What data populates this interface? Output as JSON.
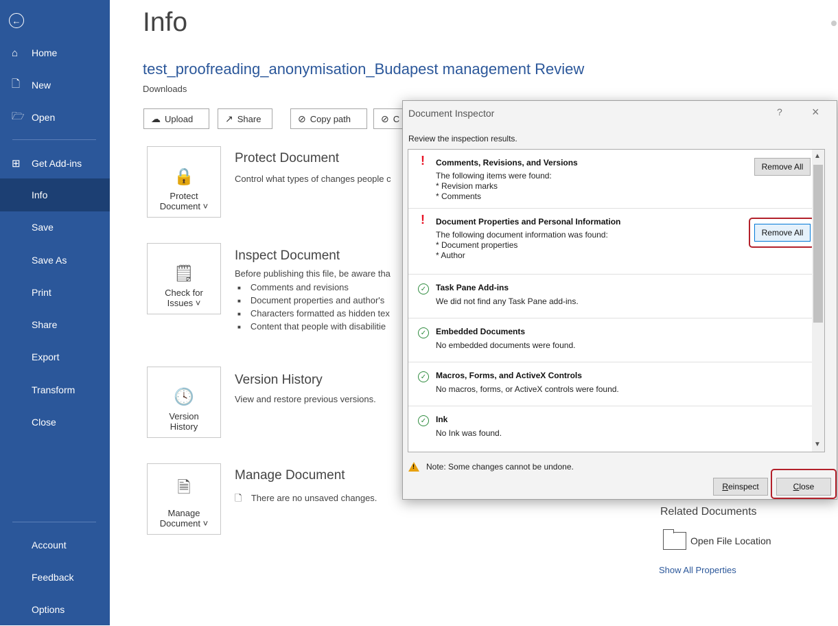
{
  "sidebar": {
    "back_icon": "back-arrow-icon",
    "items": [
      {
        "label": "Home",
        "icon": "home-icon"
      },
      {
        "label": "New",
        "icon": "new-document-icon"
      },
      {
        "label": "Open",
        "icon": "folder-open-icon"
      },
      {
        "label": "Get Add-ins",
        "icon": "add-ins-grid-icon"
      },
      {
        "label": "Info",
        "active": true
      },
      {
        "label": "Save"
      },
      {
        "label": "Save As"
      },
      {
        "label": "Print"
      },
      {
        "label": "Share"
      },
      {
        "label": "Export"
      },
      {
        "label": "Transform"
      },
      {
        "label": "Close"
      }
    ],
    "bottom_items": [
      {
        "label": "Account"
      },
      {
        "label": "Feedback"
      },
      {
        "label": "Options"
      }
    ]
  },
  "main": {
    "title": "Info",
    "doc_title": "test_proofreading_anonymisation_Budapest management Review",
    "location": "Downloads",
    "actions": [
      {
        "label": "Upload",
        "icon": "cloud-upload-icon"
      },
      {
        "label": "Share",
        "icon": "share-icon"
      },
      {
        "label": "Copy path",
        "icon": "link-icon"
      },
      {
        "label": "C",
        "icon": "link-icon"
      }
    ],
    "protect": {
      "tile_line1": "Protect",
      "tile_line2": "Document ˅",
      "heading": "Protect Document",
      "desc": "Control what types of changes people c"
    },
    "inspect": {
      "tile_line1": "Check for",
      "tile_line2": "Issues ˅",
      "heading": "Inspect Document",
      "desc": "Before publishing this file, be aware tha",
      "bullets": [
        "Comments and revisions",
        "Document properties and author's",
        "Characters formatted as hidden tex",
        "Content that people with disabilitie"
      ]
    },
    "version": {
      "tile_line1": "Version",
      "tile_line2": "History",
      "heading": "Version History",
      "desc": "View and restore previous versions."
    },
    "manage": {
      "tile_line1": "Manage",
      "tile_line2": "Document ˅",
      "heading": "Manage Document",
      "no_changes": "There are no unsaved changes."
    },
    "related": {
      "heading": "Related Documents",
      "open_location": "Open File Location",
      "show_all": "Show All Properties"
    }
  },
  "dialog": {
    "title": "Document Inspector",
    "help": "?",
    "close_x": "×",
    "subtitle": "Review the inspection results.",
    "results": [
      {
        "title": "Comments, Revisions, and Versions",
        "status": "warning",
        "lines": [
          "The following items were found:",
          "* Revision marks",
          "* Comments"
        ],
        "button": "Remove All"
      },
      {
        "title": "Document Properties and Personal Information",
        "status": "warning",
        "lines": [
          "The following document information was found:",
          "* Document properties",
          "* Author"
        ],
        "button": "Remove All"
      },
      {
        "title": "Task Pane Add-ins",
        "status": "ok",
        "lines": [
          "We did not find any Task Pane add-ins."
        ]
      },
      {
        "title": "Embedded Documents",
        "status": "ok",
        "lines": [
          "No embedded documents were found."
        ]
      },
      {
        "title": "Macros, Forms, and ActiveX Controls",
        "status": "ok",
        "lines": [
          "No macros, forms, or ActiveX controls were found."
        ]
      },
      {
        "title": "Ink",
        "status": "ok",
        "lines": [
          "No Ink was found."
        ]
      }
    ],
    "note": "Note: Some changes cannot be undone.",
    "reinspect": {
      "first": "R",
      "rest": "einspect"
    },
    "close": {
      "first": "C",
      "rest": "lose"
    },
    "colors": {
      "warning": "#e81123",
      "ok": "#2e8b3e",
      "highlight": "#b3202a",
      "sidebar": "#2b579a"
    }
  }
}
